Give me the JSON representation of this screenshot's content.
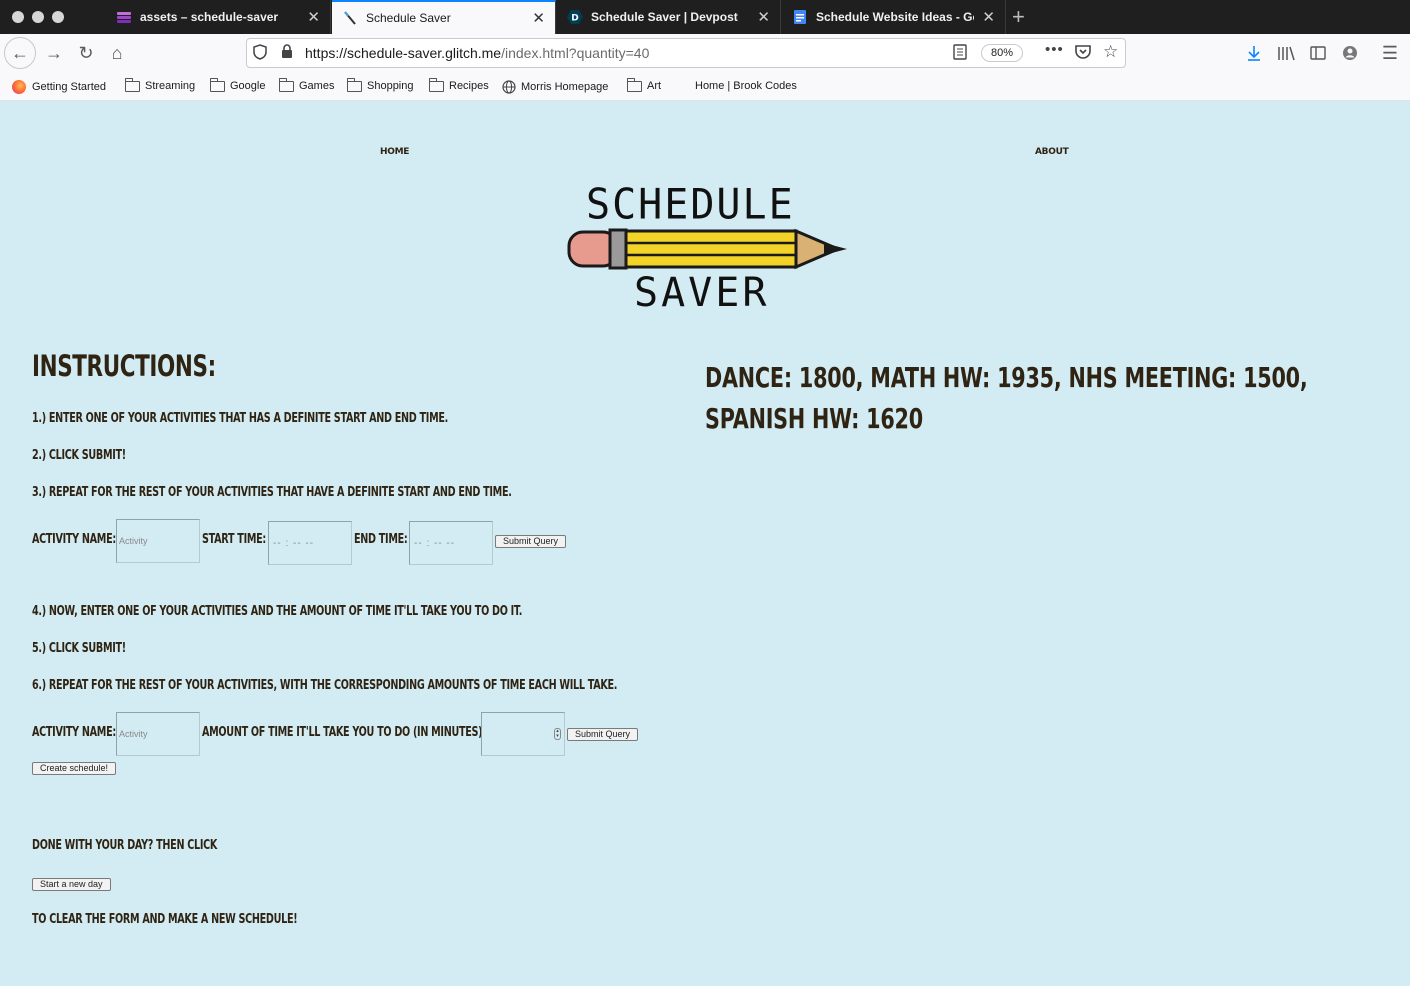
{
  "browser": {
    "tabs": [
      {
        "title": "assets – schedule-saver",
        "icon": "glitch-fish-icon"
      },
      {
        "title": "Schedule Saver",
        "icon": "pencil-icon"
      },
      {
        "title": "Schedule Saver | Devpost",
        "icon": "devpost-icon"
      },
      {
        "title": "Schedule Website Ideas - Goog",
        "icon": "google-docs-icon"
      }
    ],
    "url_host": "https://schedule-saver.glitch.me",
    "url_rest": "/index.html?quantity=40",
    "zoom": "80%",
    "bookmarks": [
      "Getting Started",
      "Streaming",
      "Google",
      "Games",
      "Shopping",
      "Recipes",
      "Morris Homepage",
      "Art",
      "Home | Brook Codes"
    ]
  },
  "site": {
    "nav": {
      "home": "Home",
      "about": "About"
    },
    "logo": {
      "top": "SCHEDULE",
      "bottom": "SAVER"
    },
    "instructions_heading": "Instructions:",
    "steps": [
      "1.) Enter one of your activities that has a definite start and end time.",
      "2.) Click submit!",
      "3.) Repeat for the rest of your activities that have a definite start and end time.",
      "4.) Now, enter one of your activities and the amount of time it'll take you to do it.",
      "5.) Click submit!",
      "6.) Repeat for the rest of your activities, with the corresponding amounts of time each will take."
    ],
    "form1": {
      "activity_label": "Activity Name:",
      "activity_placeholder": "Activity",
      "start_label": "Start Time:",
      "start_value": "-- : --   --",
      "end_label": "End Time:",
      "end_value": "-- : --   --",
      "submit": "Submit Query"
    },
    "form2": {
      "activity_label": "Activity Name:",
      "activity_placeholder": "Activity",
      "amount_label": "Amount of time it'll take you to do (in minutes):",
      "submit": "Submit Query",
      "create": "Create schedule!"
    },
    "done_text": "Done with your day? Then click",
    "new_day_button": "Start a new day",
    "clear_text": "to clear the form and make a new schedule!",
    "schedule_output": "Dance: 1800, Math HW: 1935, NHS Meeting: 1500, Spanish HW: 1620"
  },
  "colors": {
    "page_bg": "#d3ebf2",
    "text_brown": "#2f2413",
    "accent_blue": "#0a84ff",
    "pencil_yellow": "#f3d327",
    "eraser_pink": "#e79b8f"
  }
}
